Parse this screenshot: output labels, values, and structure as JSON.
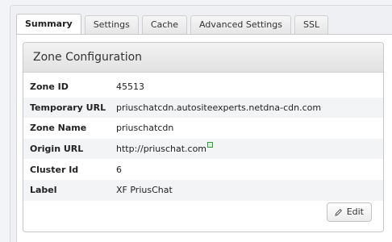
{
  "tabs": [
    {
      "label": "Summary",
      "active": true
    },
    {
      "label": "Settings",
      "active": false
    },
    {
      "label": "Cache",
      "active": false
    },
    {
      "label": "Advanced Settings",
      "active": false
    },
    {
      "label": "SSL",
      "active": false
    }
  ],
  "zone_card": {
    "title": "Zone Configuration",
    "rows": [
      {
        "label": "Zone ID",
        "value": "45513"
      },
      {
        "label": "Temporary URL",
        "value": "priuschatcdn.autositeexperts.netdna-cdn.com"
      },
      {
        "label": "Zone Name",
        "value": "priuschatcdn"
      },
      {
        "label": "Origin URL",
        "value": "http://priuschat.com"
      },
      {
        "label": "Cluster Id",
        "value": "6"
      },
      {
        "label": "Label",
        "value": "XF PriusChat"
      }
    ],
    "edit_label": "Edit"
  },
  "icons": {
    "origin_url_link": "external-link-icon",
    "edit": "pencil-icon"
  },
  "colors": {
    "link_icon": "#2e9e3a",
    "card_header_bg": "#e8e8e8",
    "alt_row_bg": "#f3f4f5"
  }
}
